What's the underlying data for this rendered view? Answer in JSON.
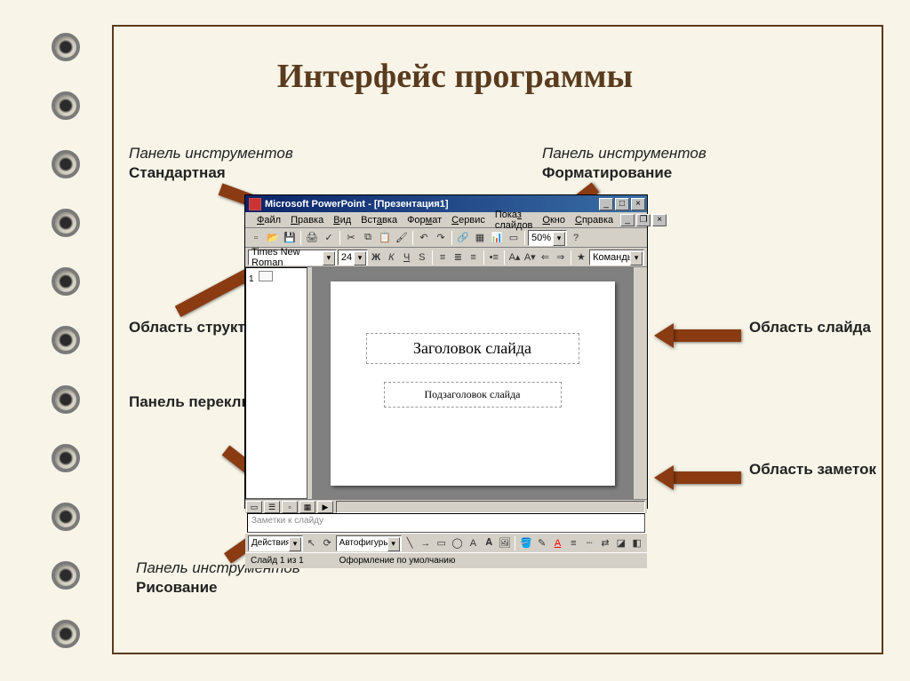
{
  "slide_title": "Интерфейс программы",
  "labels": {
    "std_toolbar_i": "Панель инструментов",
    "std_toolbar_b": "Стандартная",
    "fmt_toolbar_i": "Панель инструментов",
    "fmt_toolbar_b": "Форматирование",
    "outline_area": "Область структуры",
    "slide_area": "Область слайда",
    "view_switch": "Панель переключения режимов",
    "notes_area": "Область заметок",
    "draw_toolbar_i": "Панель инструментов",
    "draw_toolbar_b": "Рисование"
  },
  "pp": {
    "title": "Microsoft PowerPoint - [Презентация1]",
    "menus": [
      "Файл",
      "Правка",
      "Вид",
      "Вставка",
      "Формат",
      "Сервис",
      "Показ слайдов",
      "Окно",
      "Справка"
    ],
    "font_name": "Times New Roman",
    "font_size": "24",
    "zoom": "50%",
    "commands_label": "Команды",
    "actions_label": "Действия",
    "autoshapes_label": "Автофигуры",
    "slide_title_ph": "Заголовок слайда",
    "slide_sub_ph": "Подзаголовок слайда",
    "notes_placeholder": "Заметки к слайду",
    "status_slide": "Слайд 1 из 1",
    "status_design": "Оформление по умолчанию",
    "outline_num": "1"
  }
}
